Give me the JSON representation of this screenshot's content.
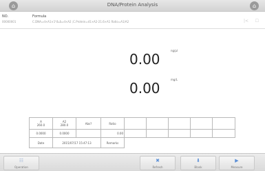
{
  "header": {
    "title": "DNA/Protein Analysis",
    "left_icon": "home-icon",
    "right_icon": "home-icon"
  },
  "info": {
    "no_label": "NO.",
    "no_value": "00000001",
    "formula_label": "Formula",
    "formula_text": "C.DNA=d×A1×1*Δ.Δ=d×A2 ;C.Protein=d1×A2-21.6×A1 Ratio=A1/A2",
    "ctrl_a": "|<",
    "ctrl_b": "☐"
  },
  "readings": {
    "value1": "0.00",
    "unit1": "ng/μl",
    "value2": "0.00",
    "unit2": "mg/L"
  },
  "table": {
    "header": [
      "A\n260.0",
      "A2\n280.0",
      "Abs?",
      "Ratio",
      "",
      "",
      "",
      "",
      ""
    ],
    "values": [
      "0.0000",
      "0.0000",
      "",
      "0.00",
      "",
      "",
      "",
      "",
      ""
    ],
    "date_label": "Date",
    "date_value": "2015/07/17 15:47:13",
    "remarks_label": "Remarks"
  },
  "toolbar": {
    "operation_label": "Operation",
    "refresh_label": "Refresh",
    "blank_label": "Blank",
    "measure_label": "Measure",
    "operation_icon": "grid-icon",
    "refresh_icon": "tools-icon",
    "blank_icon": "tray-icon",
    "measure_icon": "play-icon"
  },
  "colors": {
    "accent": "#5b8fd6",
    "bar": "#dadada"
  }
}
